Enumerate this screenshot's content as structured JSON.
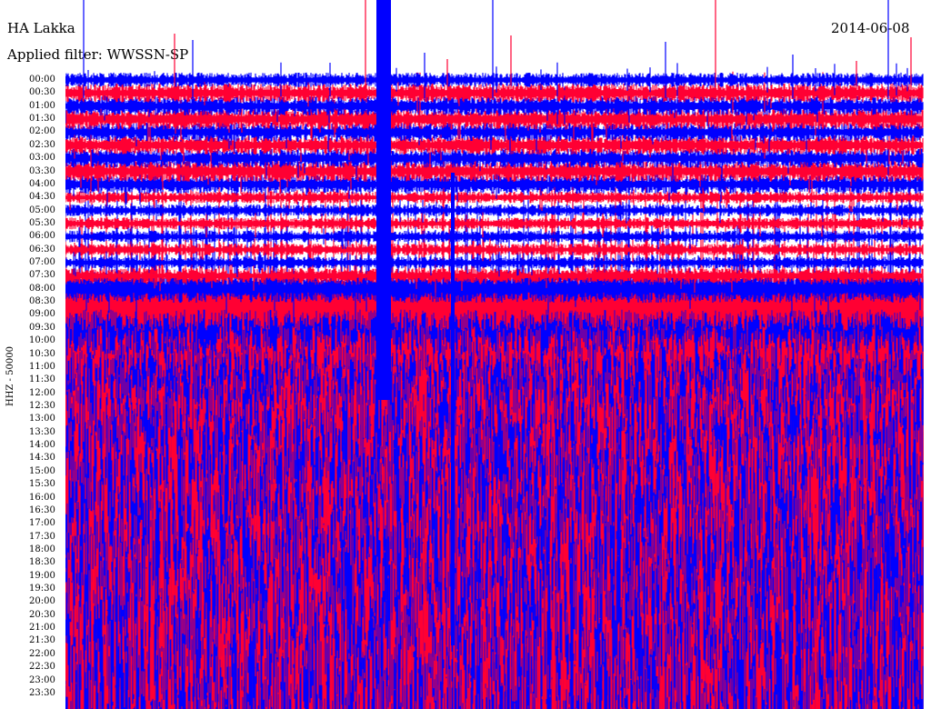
{
  "header": {
    "station": "HA Lakka",
    "date": "2014-06-08",
    "filter": "Applied filter: WWSSN-SP"
  },
  "colors": {
    "trace_a": "#ff0033",
    "trace_b": "#0000ff",
    "background": "#ffffff"
  },
  "chart_data": {
    "type": "helicorder",
    "title": "HA Lakka",
    "date": "2014-06-08",
    "filter": "WWSSN-SP",
    "ylabel": "HHZ - 50000",
    "row_labels": [
      "00:00",
      "00:30",
      "01:00",
      "01:30",
      "02:00",
      "02:30",
      "03:00",
      "03:30",
      "04:00",
      "04:30",
      "05:00",
      "05:30",
      "06:00",
      "06:30",
      "07:00",
      "07:30",
      "08:00",
      "08:30",
      "09:00",
      "09:30",
      "10:00",
      "10:30",
      "11:00",
      "11:30",
      "12:00",
      "12:30",
      "13:00",
      "13:30",
      "14:00",
      "14:30",
      "15:00",
      "15:30",
      "16:00",
      "16:30",
      "17:00",
      "17:30",
      "18:00",
      "18:30",
      "19:00",
      "19:30",
      "20:00",
      "20:30",
      "21:00",
      "21:30",
      "22:00",
      "22:30",
      "23:00",
      "23:30"
    ],
    "minutes_per_row": 30,
    "series": [
      {
        "color": "#0000ff",
        "rows": "odd-hour rows"
      },
      {
        "color": "#ff0033",
        "rows": "half-hour rows"
      }
    ],
    "relative_amplitude": [
      0.6,
      0.8,
      0.8,
      0.9,
      0.8,
      0.8,
      0.8,
      0.9,
      0.8,
      0.5,
      0.5,
      0.5,
      0.5,
      0.5,
      0.5,
      0.6,
      1.2,
      2.5,
      3.5,
      4.5,
      5.5,
      6.5,
      7.0,
      7.5,
      8.0,
      8.5,
      9.0,
      9.5,
      10.0,
      10.0,
      10.5,
      10.5,
      11.0,
      11.0,
      11.5,
      11.5,
      12.0,
      12.0,
      12.5,
      12.5,
      13.0,
      13.0,
      13.5,
      13.5,
      14.0,
      14.5,
      15.0,
      15.0
    ]
  }
}
